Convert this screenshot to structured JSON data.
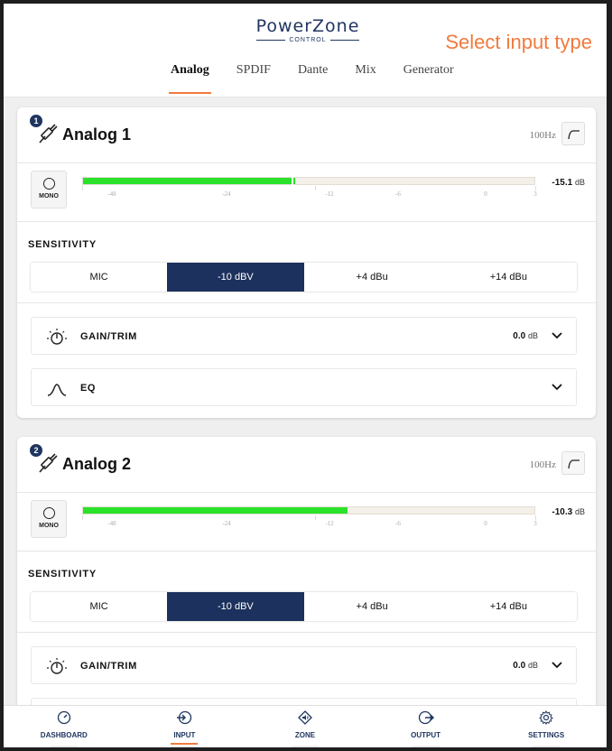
{
  "app": {
    "logo_title": "PowerZone",
    "logo_subtitle": "CONTROL",
    "hint": "Select input type"
  },
  "tabs": [
    {
      "label": "Analog",
      "active": true
    },
    {
      "label": "SPDIF",
      "active": false
    },
    {
      "label": "Dante",
      "active": false
    },
    {
      "label": "Mix",
      "active": false
    },
    {
      "label": "Generator",
      "active": false
    }
  ],
  "channels": [
    {
      "number": "1",
      "title": "Analog 1",
      "hpf": "100Hz",
      "mono_label": "MONO",
      "level_db": "-15.1",
      "level_unit": "dB",
      "meter_fraction": 0.47,
      "sensitivity_label": "SENSITIVITY",
      "sensitivity_options": [
        "MIC",
        "-10 dBV",
        "+4 dBu",
        "+14 dBu"
      ],
      "sensitivity_selected": 1,
      "gain_label": "GAIN/TRIM",
      "gain_value": "0.0",
      "gain_unit": "dB",
      "eq_label": "EQ"
    },
    {
      "number": "2",
      "title": "Analog 2",
      "hpf": "100Hz",
      "mono_label": "MONO",
      "level_db": "-10.3",
      "level_unit": "dB",
      "meter_fraction": 0.585,
      "sensitivity_label": "SENSITIVITY",
      "sensitivity_options": [
        "MIC",
        "-10 dBV",
        "+4 dBu",
        "+14 dBu"
      ],
      "sensitivity_selected": 1,
      "gain_label": "GAIN/TRIM",
      "gain_value": "0.0",
      "gain_unit": "dB"
    }
  ],
  "meter_scale": [
    "-48",
    "-24",
    "-12",
    "-6",
    "0",
    "3"
  ],
  "bottom_nav": [
    {
      "label": "DASHBOARD",
      "icon": "gauge-icon",
      "active": false
    },
    {
      "label": "INPUT",
      "icon": "input-icon",
      "active": true
    },
    {
      "label": "ZONE",
      "icon": "speaker-icon",
      "active": false
    },
    {
      "label": "OUTPUT",
      "icon": "output-icon",
      "active": false
    },
    {
      "label": "SETTINGS",
      "icon": "gear-icon",
      "active": false
    }
  ],
  "colors": {
    "accent": "#ef7b3e",
    "navy": "#1c315d",
    "meter_green": "#2ae22a"
  }
}
